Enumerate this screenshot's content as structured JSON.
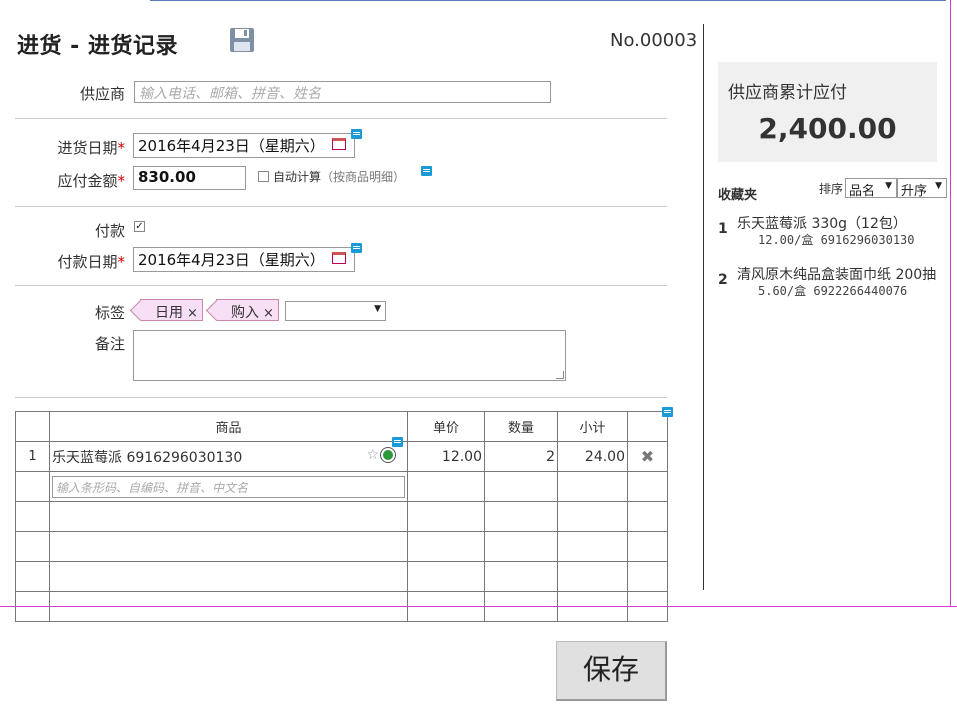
{
  "header": {
    "title": "进货  - 进货记录",
    "doc_no": "No.00003"
  },
  "form": {
    "supplier": {
      "label": "供应商",
      "placeholder": "输入电话、邮箱、拼音、姓名"
    },
    "purchase_date": {
      "label": "进货日期",
      "required_mark": "*",
      "value": "2016年4月23日（星期六）"
    },
    "amount_due": {
      "label": "应付金额",
      "required_mark": "*",
      "value": "830.00",
      "auto_calc_label": "自动计算",
      "auto_calc_hint": "（按商品明细）"
    },
    "payment": {
      "label": "付款",
      "checked": true
    },
    "payment_date": {
      "label": "付款日期",
      "required_mark": "*",
      "value": "2016年4月23日（星期六）"
    },
    "tags": {
      "label": "标签",
      "items": [
        "日用",
        "购入"
      ],
      "remove_glyph": "×",
      "select_value": ""
    },
    "remark": {
      "label": "备注",
      "value": ""
    }
  },
  "table": {
    "columns": [
      "商品",
      "单价",
      "数量",
      "小计"
    ],
    "rows": [
      {
        "index": "1",
        "product": "乐天蓝莓派 6916296030130",
        "price": "12.00",
        "qty": "2",
        "subtotal": "24.00"
      }
    ],
    "new_row_placeholder": "输入条形码、自编码、拼音、中文名"
  },
  "save_button": "保存",
  "sidebar": {
    "summary_title": "供应商累计应付",
    "summary_value": "2,400.00",
    "favorites_title": "收藏夹",
    "sort_label": "排序",
    "sort_field": "品名",
    "sort_order": "升序",
    "favorites": [
      {
        "index": "1",
        "name": "乐天蓝莓派 330g（12包）",
        "detail": "12.00/盒  6916296030130"
      },
      {
        "index": "2",
        "name": "清风原木纯品盒装面巾纸 200抽",
        "detail": "5.60/盒  6922266440076"
      }
    ]
  },
  "colors": {
    "required": "#cc0000",
    "memo_icon": "#1a9bd8",
    "tag_bg": "#f7dff5",
    "guide_magenta": "#d23ad2"
  }
}
